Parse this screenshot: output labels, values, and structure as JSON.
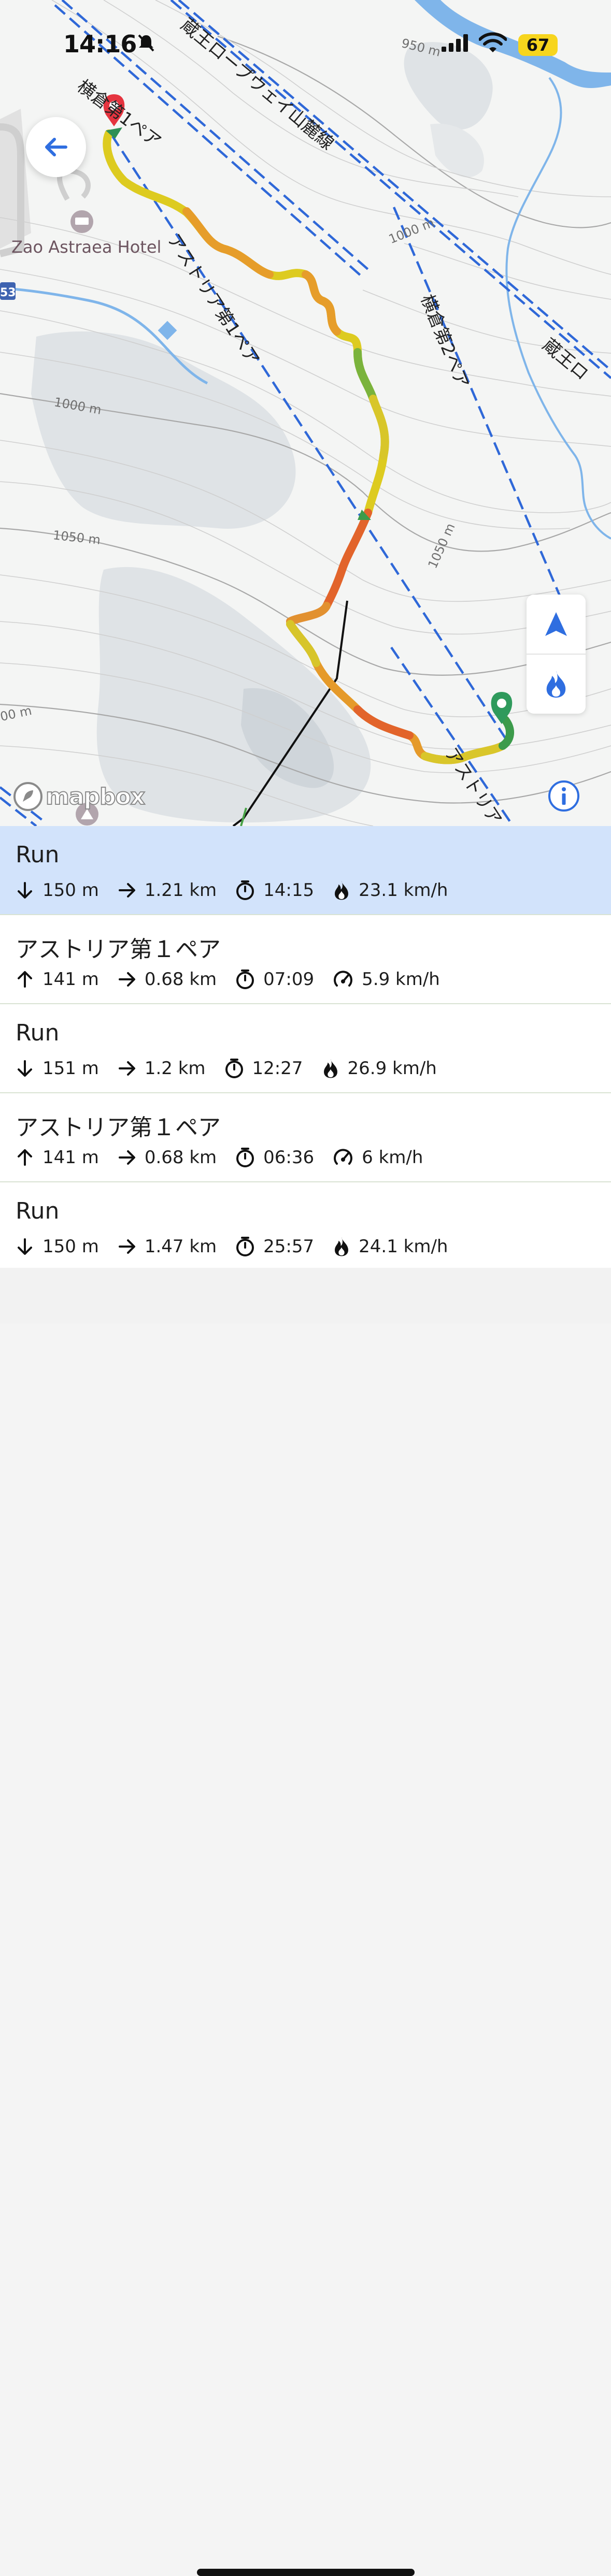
{
  "status_bar": {
    "time": "14:16",
    "battery": "67"
  },
  "map": {
    "hotel_label": "Zao Astraea Hotel",
    "road_number": "53",
    "contour_labels": [
      "950 m",
      "1000 m",
      "1000 m",
      "1050 m",
      "1050 m",
      "00 m"
    ],
    "lift_labels": [
      "横倉第1ペア",
      "蔵王ロープウェイ山麓線",
      "アストリア第1ペア",
      "横倉第2ペア",
      "蔵王ロ",
      "アストリア"
    ],
    "attribution": "mapbox"
  },
  "segments": [
    {
      "title": "Run",
      "active": true,
      "elev_dir": "down",
      "elevation": "150 m",
      "distance": "1.21 km",
      "duration": "14:15",
      "speed_icon": "fire-icon",
      "speed": "23.1 km/h"
    },
    {
      "title": "アストリア第１ペア",
      "active": false,
      "elev_dir": "up",
      "elevation": "141 m",
      "distance": "0.68 km",
      "duration": "07:09",
      "speed_icon": "speedometer-icon",
      "speed": "5.9 km/h"
    },
    {
      "title": "Run",
      "active": false,
      "elev_dir": "down",
      "elevation": "151 m",
      "distance": "1.2 km",
      "duration": "12:27",
      "speed_icon": "fire-icon",
      "speed": "26.9 km/h"
    },
    {
      "title": "アストリア第１ペア",
      "active": false,
      "elev_dir": "up",
      "elevation": "141 m",
      "distance": "0.68 km",
      "duration": "06:36",
      "speed_icon": "speedometer-icon",
      "speed": "6 km/h"
    },
    {
      "title": "Run",
      "active": false,
      "elev_dir": "down",
      "elevation": "150 m",
      "distance": "1.47 km",
      "duration": "25:57",
      "speed_icon": "fire-icon",
      "speed": "24.1 km/h"
    }
  ]
}
